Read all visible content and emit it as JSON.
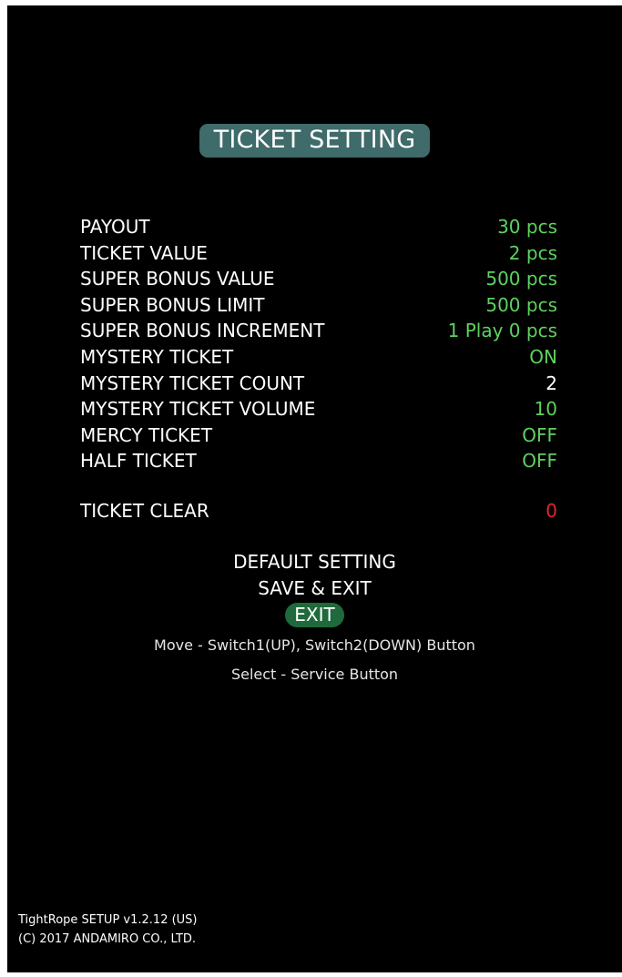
{
  "title": "TICKET SETTING",
  "colors": {
    "value_green": "#5ed15e",
    "value_white": "#ffffff",
    "value_red": "#e0262b",
    "title_bg": "#3f6b6a",
    "selected_bg": "#1f6a3c"
  },
  "settings": [
    {
      "label": "PAYOUT",
      "value": "30 pcs",
      "color": "#5ed15e"
    },
    {
      "label": "TICKET VALUE",
      "value": "2 pcs",
      "color": "#5ed15e"
    },
    {
      "label": "SUPER BONUS VALUE",
      "value": "500 pcs",
      "color": "#5ed15e"
    },
    {
      "label": "SUPER BONUS LIMIT",
      "value": "500 pcs",
      "color": "#5ed15e"
    },
    {
      "label": "SUPER BONUS INCREMENT",
      "value": "1 Play 0 pcs",
      "color": "#5ed15e"
    },
    {
      "label": "MYSTERY TICKET",
      "value": "ON",
      "color": "#5ed15e"
    },
    {
      "label": "MYSTERY TICKET COUNT",
      "value": "2",
      "color": "#ffffff"
    },
    {
      "label": "MYSTERY TICKET VOLUME",
      "value": "10",
      "color": "#5ed15e"
    },
    {
      "label": "MERCY TICKET",
      "value": "OFF",
      "color": "#5ed15e"
    },
    {
      "label": "HALF TICKET",
      "value": "OFF",
      "color": "#5ed15e"
    }
  ],
  "ticket_clear": {
    "label": "TICKET CLEAR",
    "value": "0",
    "color": "#e0262b"
  },
  "menu": {
    "default_setting": "DEFAULT SETTING",
    "save_exit": "SAVE & EXIT",
    "exit": "EXIT",
    "selected": "exit"
  },
  "help": {
    "move": "Move - Switch1(UP), Switch2(DOWN) Button",
    "select": "Select - Service Button"
  },
  "footer": {
    "version": "TightRope SETUP v1.2.12 (US)",
    "copyright": "(C) 2017 ANDAMIRO CO., LTD."
  }
}
